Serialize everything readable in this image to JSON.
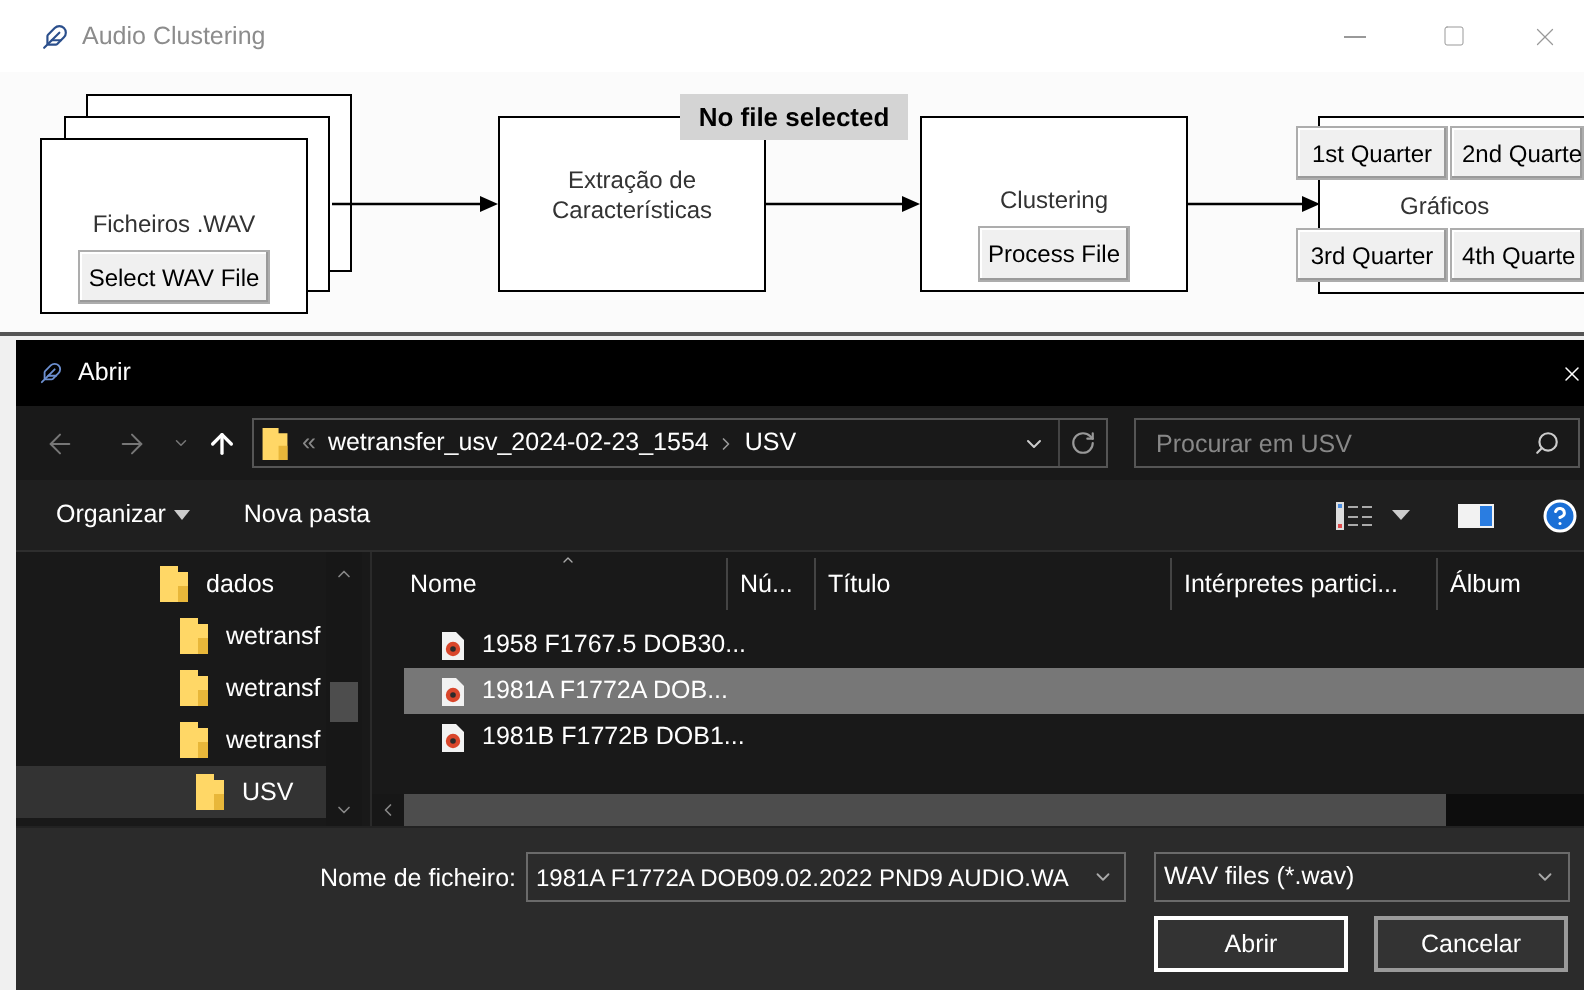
{
  "window": {
    "title": "Audio Clustering"
  },
  "diagram": {
    "input_stage": {
      "label": "Ficheiros .WAV",
      "button": "Select WAV File"
    },
    "status": "No file selected",
    "extraction_stage": {
      "label": "Extração de Características"
    },
    "clustering_stage": {
      "label": "Clustering",
      "button": "Process File"
    },
    "charts_stage": {
      "label": "Gráficos",
      "buttons": [
        "1st Quarter",
        "2nd Quarte",
        "3rd Quarter",
        "4th Quarte"
      ]
    }
  },
  "dialog": {
    "title": "Abrir",
    "breadcrumb": {
      "overflow": "«",
      "path": [
        "wetransfer_usv_2024-02-23_1554",
        "USV"
      ]
    },
    "search": {
      "placeholder": "Procurar em USV"
    },
    "toolbar": {
      "organize": "Organizar",
      "new_folder": "Nova pasta"
    },
    "nav_tree": [
      {
        "label": "dados",
        "selected": false,
        "children": [
          {
            "label": "wetransf",
            "selected": false
          },
          {
            "label": "wetransf",
            "selected": false
          },
          {
            "label": "wetransf",
            "selected": false,
            "children": [
              {
                "label": "USV",
                "selected": true
              }
            ]
          }
        ]
      }
    ],
    "columns": [
      "Nome",
      "Nú...",
      "Título",
      "Intérpretes partici...",
      "Álbum"
    ],
    "files": [
      {
        "name": "1958 F1767.5 DOB30...",
        "selected": false
      },
      {
        "name": "1981A F1772A DOB...",
        "selected": true
      },
      {
        "name": "1981B F1772B DOB1...",
        "selected": false
      }
    ],
    "file_name": {
      "label": "Nome de ficheiro:",
      "value": "1981A F1772A DOB09.02.2022 PND9 AUDIO.WA"
    },
    "file_type": "WAV files (*.wav)",
    "buttons": [
      "Abrir",
      "Cancelar"
    ]
  }
}
